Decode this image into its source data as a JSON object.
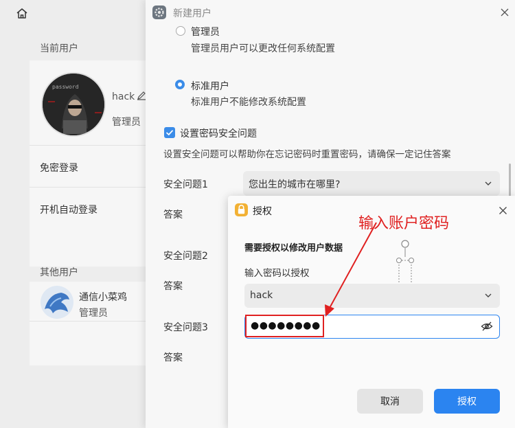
{
  "left_panel": {
    "current_users_title": "当前用户",
    "current_user": {
      "name": "hack",
      "role": "管理员"
    },
    "passwordless_login": "免密登录",
    "auto_login": "开机自动登录",
    "other_users_title": "其他用户",
    "other_user": {
      "name": "通信小菜鸡",
      "role": "管理员"
    }
  },
  "new_user_window": {
    "title": "新建用户",
    "admin_option": {
      "label": "管理员",
      "description": "管理员用户可以更改任何系统配置",
      "selected": false
    },
    "standard_option": {
      "label": "标准用户",
      "description": "标准用户不能修改系统配置",
      "selected": true
    },
    "security_question_checkbox": {
      "label": "设置密码安全问题",
      "checked": true
    },
    "security_hint": "设置安全问题可以帮助你在忘记密码时重置密码，请确保一定记住答案",
    "question1_label": "安全问题1",
    "question1_value": "您出生的城市在哪里?",
    "answer_label": "答案",
    "question2_label": "安全问题2",
    "question3_label": "安全问题3"
  },
  "auth_dialog": {
    "title": "授权",
    "message": "需要授权以修改用户数据",
    "prompt": "输入密码以授权",
    "user_select": "hack",
    "password_mask": "●●●●●●●●",
    "cancel_label": "取消",
    "authorize_label": "授权",
    "primary_color": "#2b84f0"
  },
  "annotation": {
    "text": "输入账户密码",
    "color": "#e02020"
  }
}
